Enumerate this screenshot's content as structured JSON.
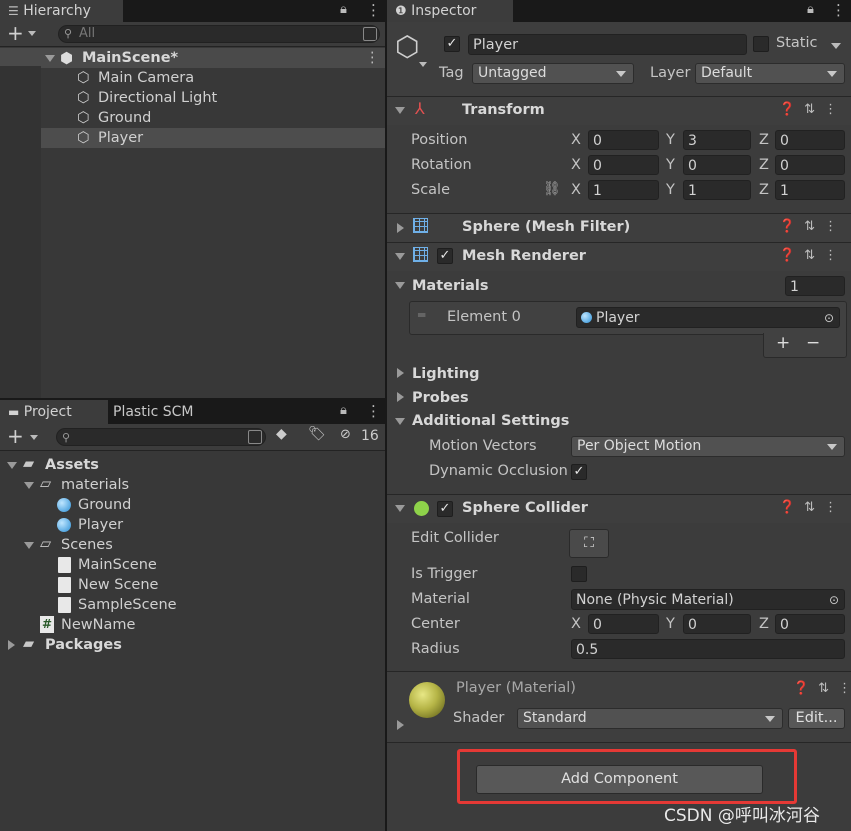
{
  "hierarchy": {
    "tab_label": "Hierarchy",
    "search_placeholder": "All",
    "scene_name": "MainScene*",
    "items": [
      "Main Camera",
      "Directional Light",
      "Ground",
      "Player"
    ]
  },
  "project": {
    "tabs": [
      "Project",
      "Plastic SCM"
    ],
    "hidden_count": "16",
    "tree": {
      "assets": "Assets",
      "materials": "materials",
      "ground": "Ground",
      "player": "Player",
      "scenes": "Scenes",
      "main_scene": "MainScene",
      "new_scene": "New Scene",
      "sample_scene": "SampleScene",
      "script": "NewName",
      "packages": "Packages"
    }
  },
  "inspector": {
    "tab_label": "Inspector",
    "object_name": "Player",
    "static_label": "Static",
    "tag_label": "Tag",
    "tag_value": "Untagged",
    "layer_label": "Layer",
    "layer_value": "Default",
    "transform": {
      "title": "Transform",
      "position_label": "Position",
      "rotation_label": "Rotation",
      "scale_label": "Scale",
      "x": "X",
      "y": "Y",
      "z": "Z",
      "position": [
        "0",
        "3",
        "0"
      ],
      "rotation": [
        "0",
        "0",
        "0"
      ],
      "scale": [
        "1",
        "1",
        "1"
      ]
    },
    "mesh_filter": {
      "title": "Sphere (Mesh Filter)"
    },
    "mesh_renderer": {
      "title": "Mesh Renderer",
      "materials_label": "Materials",
      "materials_count": "1",
      "element_label": "Element 0",
      "element_value": "Player",
      "plus": "+",
      "minus": "−",
      "lighting": "Lighting",
      "probes": "Probes",
      "additional_settings": "Additional Settings",
      "motion_vectors_label": "Motion Vectors",
      "motion_vectors_value": "Per Object Motion",
      "dynamic_occlusion_label": "Dynamic Occlusion"
    },
    "sphere_collider": {
      "title": "Sphere Collider",
      "edit_collider_label": "Edit Collider",
      "is_trigger_label": "Is Trigger",
      "material_label": "Material",
      "material_value": "None (Physic Material)",
      "center_label": "Center",
      "center": [
        "0",
        "0",
        "0"
      ],
      "radius_label": "Radius",
      "radius_value": "0.5"
    },
    "material": {
      "title": "Player (Material)",
      "shader_label": "Shader",
      "shader_value": "Standard",
      "edit_button": "Edit..."
    },
    "add_component": "Add Component"
  },
  "watermark": "CSDN @呼叫冰河谷",
  "colors": {
    "background": "#383838",
    "highlight": "#e53935",
    "material_sphere": "#b5b446",
    "sphere_icon": "#8ed24a"
  }
}
